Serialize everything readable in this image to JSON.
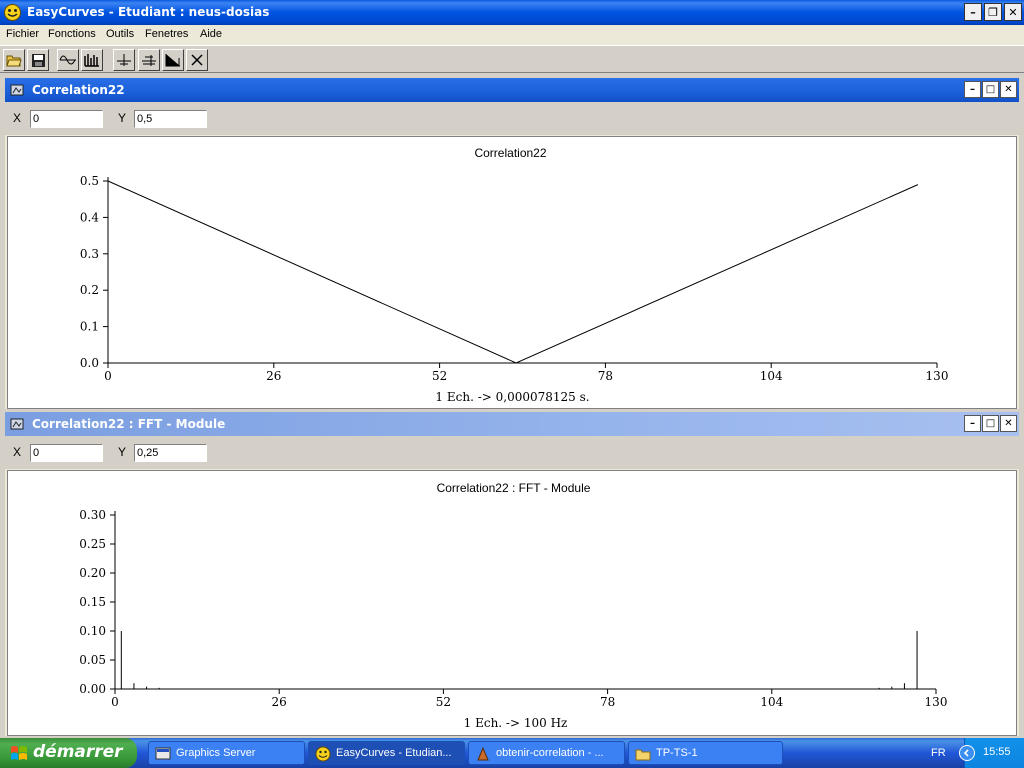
{
  "app": {
    "title": "EasyCurves - Etudiant : neus-dosias",
    "buttons": {
      "minimize": "–",
      "restore": "❐",
      "close": "✕"
    }
  },
  "menu": [
    "Fichier",
    "Fonctions",
    "Outils",
    "Fenetres",
    "Aide"
  ],
  "toolbar": {
    "tools": [
      "open-icon",
      "save-icon",
      "signal-icon",
      "comb-icon",
      "cursor-icon",
      "cursor2-icon",
      "spectrum-icon",
      "close-icon"
    ]
  },
  "windows": [
    {
      "title": "Correlation22",
      "x_label": "X",
      "x_value": "0",
      "y_label": "Y",
      "y_value": "0,5",
      "active": true
    },
    {
      "title": "Correlation22 : FFT - Module",
      "x_label": "X",
      "x_value": "0",
      "y_label": "Y",
      "y_value": "0,25",
      "active": false
    }
  ],
  "chart_data": [
    {
      "type": "line",
      "title": "Correlation22",
      "xlabel": "1 Ech. -> 0,000078125 s.",
      "ylabel": "",
      "xlim": [
        0,
        130
      ],
      "ylim": [
        0,
        0.5
      ],
      "xticks": [
        "0",
        "26",
        "52",
        "78",
        "104",
        "130"
      ],
      "yticks": [
        "0.0",
        "0.1",
        "0.2",
        "0.3",
        "0.4",
        "0.5"
      ],
      "x": [
        0,
        64,
        127
      ],
      "y": [
        0.5,
        0.0,
        0.49
      ],
      "grid": false
    },
    {
      "type": "bar",
      "title": "Correlation22 : FFT - Module",
      "xlabel": "1 Ech. -> 100 Hz",
      "ylabel": "",
      "xlim": [
        0,
        130
      ],
      "ylim": [
        0,
        0.3
      ],
      "xticks": [
        "0",
        "26",
        "52",
        "78",
        "104",
        "130"
      ],
      "yticks": [
        "0.00",
        "0.05",
        "0.10",
        "0.15",
        "0.20",
        "0.25",
        "0.30"
      ],
      "x": [
        1,
        3,
        5,
        7,
        121,
        123,
        125,
        127
      ],
      "y": [
        0.1,
        0.01,
        0.004,
        0.002,
        0.002,
        0.004,
        0.01,
        0.1
      ],
      "grid": false
    }
  ],
  "taskbar": {
    "start_label": "démarrer",
    "tasks": [
      {
        "label": "Graphics Server",
        "icon": "graphics-server-icon"
      },
      {
        "label": "EasyCurves - Etudian...",
        "icon": "easycurves-icon"
      },
      {
        "label": "obtenir-correlation - ...",
        "icon": "scilab-icon"
      },
      {
        "label": "TP-TS-1",
        "icon": "folder-icon"
      }
    ],
    "lang": "FR",
    "clock": "15:55"
  }
}
